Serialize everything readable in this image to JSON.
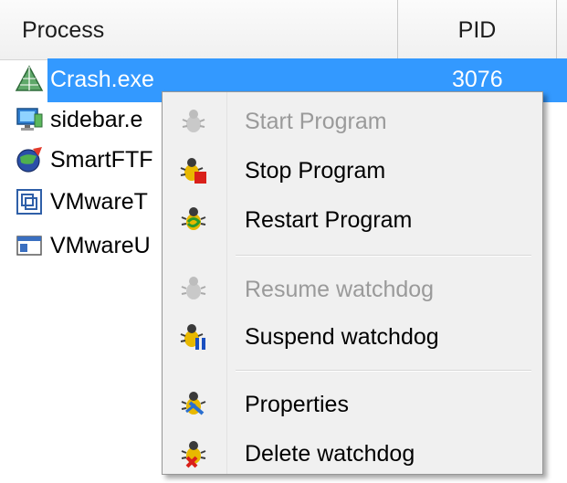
{
  "columns": {
    "process": "Process",
    "pid": "PID"
  },
  "rows": [
    {
      "name": "Crash.exe",
      "pid": "3076",
      "icon": "pyramid-icon",
      "selected": true
    },
    {
      "name": "sidebar.e",
      "pid": "",
      "icon": "monitor-icon"
    },
    {
      "name": "SmartFTF",
      "pid": "",
      "icon": "globe-icon"
    },
    {
      "name": "VMwareT",
      "pid": "",
      "icon": "vmware-icon"
    },
    {
      "name": "VMwareU",
      "pid": "",
      "icon": "window-icon"
    }
  ],
  "menu": {
    "items": [
      {
        "label": "Start Program",
        "enabled": false,
        "icon": "bug-start-icon"
      },
      {
        "label": "Stop Program",
        "enabled": true,
        "icon": "bug-stop-icon"
      },
      {
        "label": "Restart Program",
        "enabled": true,
        "icon": "bug-restart-icon"
      },
      {
        "label": "Resume watchdog",
        "enabled": false,
        "icon": "bug-resume-icon"
      },
      {
        "label": "Suspend watchdog",
        "enabled": true,
        "icon": "bug-suspend-icon"
      },
      {
        "label": "Properties",
        "enabled": true,
        "icon": "bug-properties-icon"
      },
      {
        "label": "Delete watchdog",
        "enabled": true,
        "icon": "bug-delete-icon"
      }
    ]
  },
  "colors": {
    "selection": "#3399ff",
    "disabled_text": "#9a9a9a",
    "menu_bg": "#f0f0f0"
  }
}
